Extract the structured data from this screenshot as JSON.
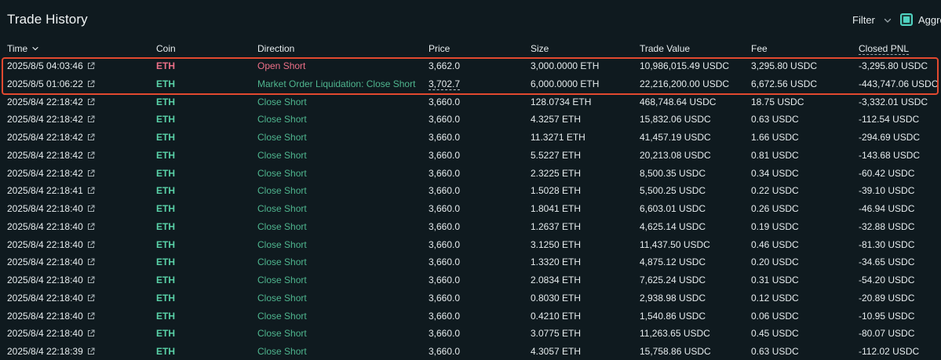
{
  "header": {
    "title": "Trade History",
    "filter_label": "Filter",
    "aggregate_label": "Aggre"
  },
  "columns": {
    "time": "Time",
    "coin": "Coin",
    "direction": "Direction",
    "price": "Price",
    "size": "Size",
    "trade_value": "Trade Value",
    "fee": "Fee",
    "closed_pnl": "Closed PNL"
  },
  "colors": {
    "background": "#0f1a1f",
    "highlight_border": "#e2492f",
    "long_green": "#4fb68f",
    "short_red": "#ed7088",
    "accent": "#50d2c1"
  },
  "rows": [
    {
      "time": "2025/8/5 04:03:46",
      "coin": "ETH",
      "coin_side": "short",
      "direction": "Open Short",
      "dir_side": "short",
      "price": "3,662.0",
      "price_dashed": false,
      "size": "3,000.0000 ETH",
      "value": "10,986,015.49 USDC",
      "fee": "3,295.80 USDC",
      "pnl": "-3,295.80 USDC"
    },
    {
      "time": "2025/8/5 01:06:22",
      "coin": "ETH",
      "coin_side": "long",
      "direction": "Market Order Liquidation: Close Short",
      "dir_side": "long",
      "price": "3,702.7",
      "price_dashed": true,
      "size": "6,000.0000 ETH",
      "value": "22,216,200.00 USDC",
      "fee": "6,672.56 USDC",
      "pnl": "-443,747.06 USDC"
    },
    {
      "time": "2025/8/4 22:18:42",
      "coin": "ETH",
      "coin_side": "long",
      "direction": "Close Short",
      "dir_side": "long",
      "price": "3,660.0",
      "price_dashed": false,
      "size": "128.0734 ETH",
      "value": "468,748.64 USDC",
      "fee": "18.75 USDC",
      "pnl": "-3,332.01 USDC"
    },
    {
      "time": "2025/8/4 22:18:42",
      "coin": "ETH",
      "coin_side": "long",
      "direction": "Close Short",
      "dir_side": "long",
      "price": "3,660.0",
      "price_dashed": false,
      "size": "4.3257 ETH",
      "value": "15,832.06 USDC",
      "fee": "0.63 USDC",
      "pnl": "-112.54 USDC"
    },
    {
      "time": "2025/8/4 22:18:42",
      "coin": "ETH",
      "coin_side": "long",
      "direction": "Close Short",
      "dir_side": "long",
      "price": "3,660.0",
      "price_dashed": false,
      "size": "11.3271 ETH",
      "value": "41,457.19 USDC",
      "fee": "1.66 USDC",
      "pnl": "-294.69 USDC"
    },
    {
      "time": "2025/8/4 22:18:42",
      "coin": "ETH",
      "coin_side": "long",
      "direction": "Close Short",
      "dir_side": "long",
      "price": "3,660.0",
      "price_dashed": false,
      "size": "5.5227 ETH",
      "value": "20,213.08 USDC",
      "fee": "0.81 USDC",
      "pnl": "-143.68 USDC"
    },
    {
      "time": "2025/8/4 22:18:42",
      "coin": "ETH",
      "coin_side": "long",
      "direction": "Close Short",
      "dir_side": "long",
      "price": "3,660.0",
      "price_dashed": false,
      "size": "2.3225 ETH",
      "value": "8,500.35 USDC",
      "fee": "0.34 USDC",
      "pnl": "-60.42 USDC"
    },
    {
      "time": "2025/8/4 22:18:41",
      "coin": "ETH",
      "coin_side": "long",
      "direction": "Close Short",
      "dir_side": "long",
      "price": "3,660.0",
      "price_dashed": false,
      "size": "1.5028 ETH",
      "value": "5,500.25 USDC",
      "fee": "0.22 USDC",
      "pnl": "-39.10 USDC"
    },
    {
      "time": "2025/8/4 22:18:40",
      "coin": "ETH",
      "coin_side": "long",
      "direction": "Close Short",
      "dir_side": "long",
      "price": "3,660.0",
      "price_dashed": false,
      "size": "1.8041 ETH",
      "value": "6,603.01 USDC",
      "fee": "0.26 USDC",
      "pnl": "-46.94 USDC"
    },
    {
      "time": "2025/8/4 22:18:40",
      "coin": "ETH",
      "coin_side": "long",
      "direction": "Close Short",
      "dir_side": "long",
      "price": "3,660.0",
      "price_dashed": false,
      "size": "1.2637 ETH",
      "value": "4,625.14 USDC",
      "fee": "0.19 USDC",
      "pnl": "-32.88 USDC"
    },
    {
      "time": "2025/8/4 22:18:40",
      "coin": "ETH",
      "coin_side": "long",
      "direction": "Close Short",
      "dir_side": "long",
      "price": "3,660.0",
      "price_dashed": false,
      "size": "3.1250 ETH",
      "value": "11,437.50 USDC",
      "fee": "0.46 USDC",
      "pnl": "-81.30 USDC"
    },
    {
      "time": "2025/8/4 22:18:40",
      "coin": "ETH",
      "coin_side": "long",
      "direction": "Close Short",
      "dir_side": "long",
      "price": "3,660.0",
      "price_dashed": false,
      "size": "1.3320 ETH",
      "value": "4,875.12 USDC",
      "fee": "0.20 USDC",
      "pnl": "-34.65 USDC"
    },
    {
      "time": "2025/8/4 22:18:40",
      "coin": "ETH",
      "coin_side": "long",
      "direction": "Close Short",
      "dir_side": "long",
      "price": "3,660.0",
      "price_dashed": false,
      "size": "2.0834 ETH",
      "value": "7,625.24 USDC",
      "fee": "0.31 USDC",
      "pnl": "-54.20 USDC"
    },
    {
      "time": "2025/8/4 22:18:40",
      "coin": "ETH",
      "coin_side": "long",
      "direction": "Close Short",
      "dir_side": "long",
      "price": "3,660.0",
      "price_dashed": false,
      "size": "0.8030 ETH",
      "value": "2,938.98 USDC",
      "fee": "0.12 USDC",
      "pnl": "-20.89 USDC"
    },
    {
      "time": "2025/8/4 22:18:40",
      "coin": "ETH",
      "coin_side": "long",
      "direction": "Close Short",
      "dir_side": "long",
      "price": "3,660.0",
      "price_dashed": false,
      "size": "0.4210 ETH",
      "value": "1,540.86 USDC",
      "fee": "0.06 USDC",
      "pnl": "-10.95 USDC"
    },
    {
      "time": "2025/8/4 22:18:40",
      "coin": "ETH",
      "coin_side": "long",
      "direction": "Close Short",
      "dir_side": "long",
      "price": "3,660.0",
      "price_dashed": false,
      "size": "3.0775 ETH",
      "value": "11,263.65 USDC",
      "fee": "0.45 USDC",
      "pnl": "-80.07 USDC"
    },
    {
      "time": "2025/8/4 22:18:39",
      "coin": "ETH",
      "coin_side": "long",
      "direction": "Close Short",
      "dir_side": "long",
      "price": "3,660.0",
      "price_dashed": false,
      "size": "4.3057 ETH",
      "value": "15,758.86 USDC",
      "fee": "0.63 USDC",
      "pnl": "-112.02 USDC"
    }
  ]
}
